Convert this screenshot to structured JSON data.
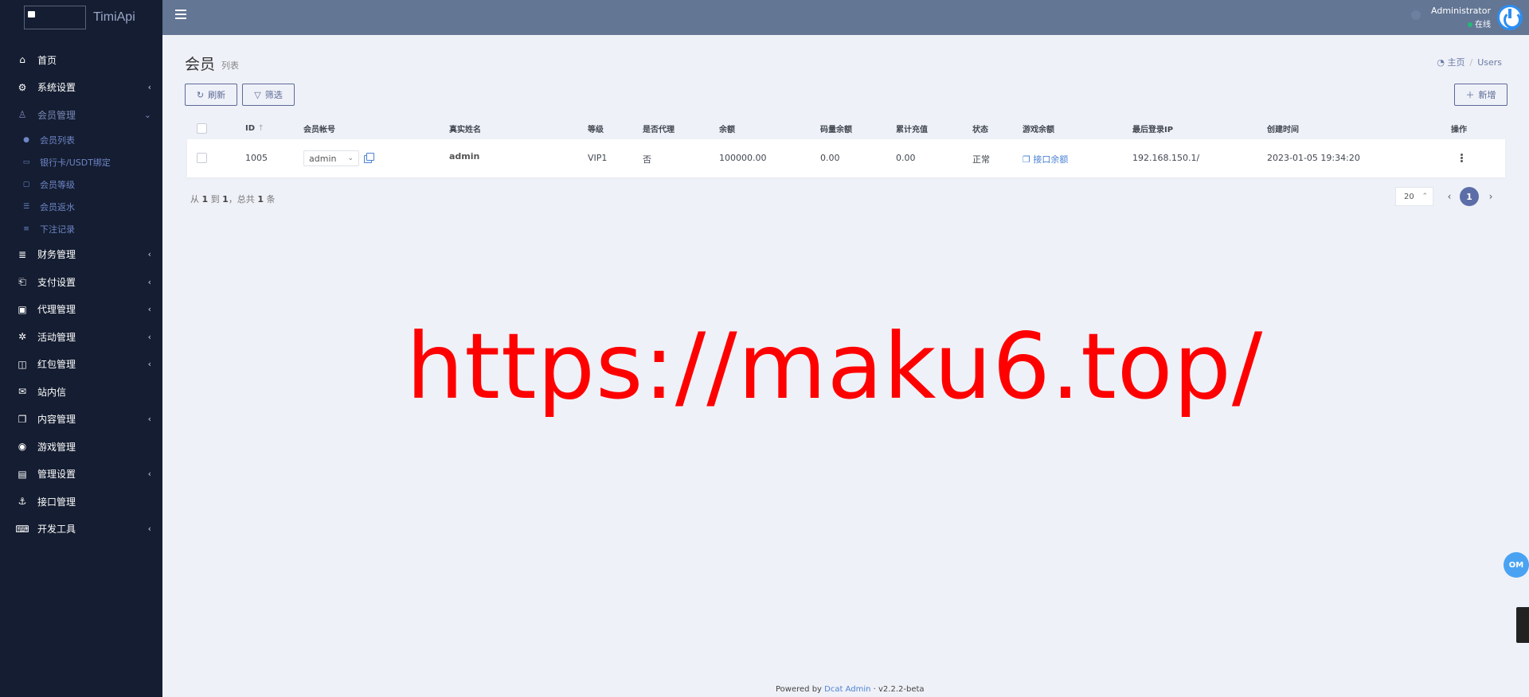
{
  "app": {
    "logo_text": "TimiApi"
  },
  "sidebar": {
    "items": [
      {
        "label": "首页",
        "icon": "home-icon",
        "has_chevron": false
      },
      {
        "label": "系统设置",
        "icon": "cogs-icon",
        "has_chevron": true
      },
      {
        "label": "会员管理",
        "icon": "user-icon",
        "has_chevron": true,
        "open": true,
        "children": [
          {
            "label": "会员列表",
            "icon": "user-small-icon"
          },
          {
            "label": "银行卡/USDT绑定",
            "icon": "card-icon"
          },
          {
            "label": "会员等级",
            "icon": "badge-icon"
          },
          {
            "label": "会员返水",
            "icon": "list-icon"
          },
          {
            "label": "下注记录",
            "icon": "record-icon"
          }
        ]
      },
      {
        "label": "财务管理",
        "icon": "database-icon",
        "has_chevron": true
      },
      {
        "label": "支付设置",
        "icon": "bookmark-icon",
        "has_chevron": true
      },
      {
        "label": "代理管理",
        "icon": "agent-icon",
        "has_chevron": true
      },
      {
        "label": "活动管理",
        "icon": "activity-icon",
        "has_chevron": true
      },
      {
        "label": "红包管理",
        "icon": "redpacket-icon",
        "has_chevron": true
      },
      {
        "label": "站内信",
        "icon": "mail-icon",
        "has_chevron": false
      },
      {
        "label": "内容管理",
        "icon": "copy-icon",
        "has_chevron": true
      },
      {
        "label": "游戏管理",
        "icon": "gamepad-icon",
        "has_chevron": false
      },
      {
        "label": "管理设置",
        "icon": "id-card-icon",
        "has_chevron": true
      },
      {
        "label": "接口管理",
        "icon": "anchor-icon",
        "has_chevron": false
      },
      {
        "label": "开发工具",
        "icon": "keyboard-icon",
        "has_chevron": true
      }
    ]
  },
  "topbar": {
    "user_name": "Administrator",
    "user_status": "在线"
  },
  "page": {
    "title": "会员",
    "subtitle": "列表"
  },
  "breadcrumb": {
    "home": "主页",
    "current": "Users"
  },
  "toolbar": {
    "refresh_label": "刷新",
    "filter_label": "筛选",
    "new_label": "新增"
  },
  "table": {
    "headers": [
      "ID",
      "会员帐号",
      "真实姓名",
      "等级",
      "是否代理",
      "余额",
      "码量余额",
      "累计充值",
      "状态",
      "游戏余额",
      "最后登录IP",
      "创建时间",
      "操作"
    ],
    "rows": [
      {
        "id": "1005",
        "account": "admin",
        "real_name": "admin",
        "level": "VIP1",
        "is_agent": "否",
        "balance": "100000.00",
        "code_balance": "0.00",
        "total_recharge": "0.00",
        "status": "正常",
        "game_balance_link": "接口余额",
        "last_ip": "192.168.150.1/",
        "created_at": "2023-01-05 19:34:20"
      }
    ]
  },
  "pagination": {
    "summary_prefix": "从",
    "from": "1",
    "to_word": "到",
    "to": "1",
    "total_prefix": "，总共",
    "total": "1",
    "total_suffix": "条",
    "page_size": "20",
    "current_page": "1"
  },
  "watermark": "https://maku6.top/",
  "float_button": "OM",
  "footer": {
    "powered_prefix": "Powered by",
    "powered_link": "Dcat Admin",
    "version": "v2.2.2-beta"
  },
  "colors": {
    "sidebar_bg": "#141d31",
    "topbar_bg": "#637694",
    "accent": "#5c6ea8",
    "watermark": "#ff0000"
  }
}
